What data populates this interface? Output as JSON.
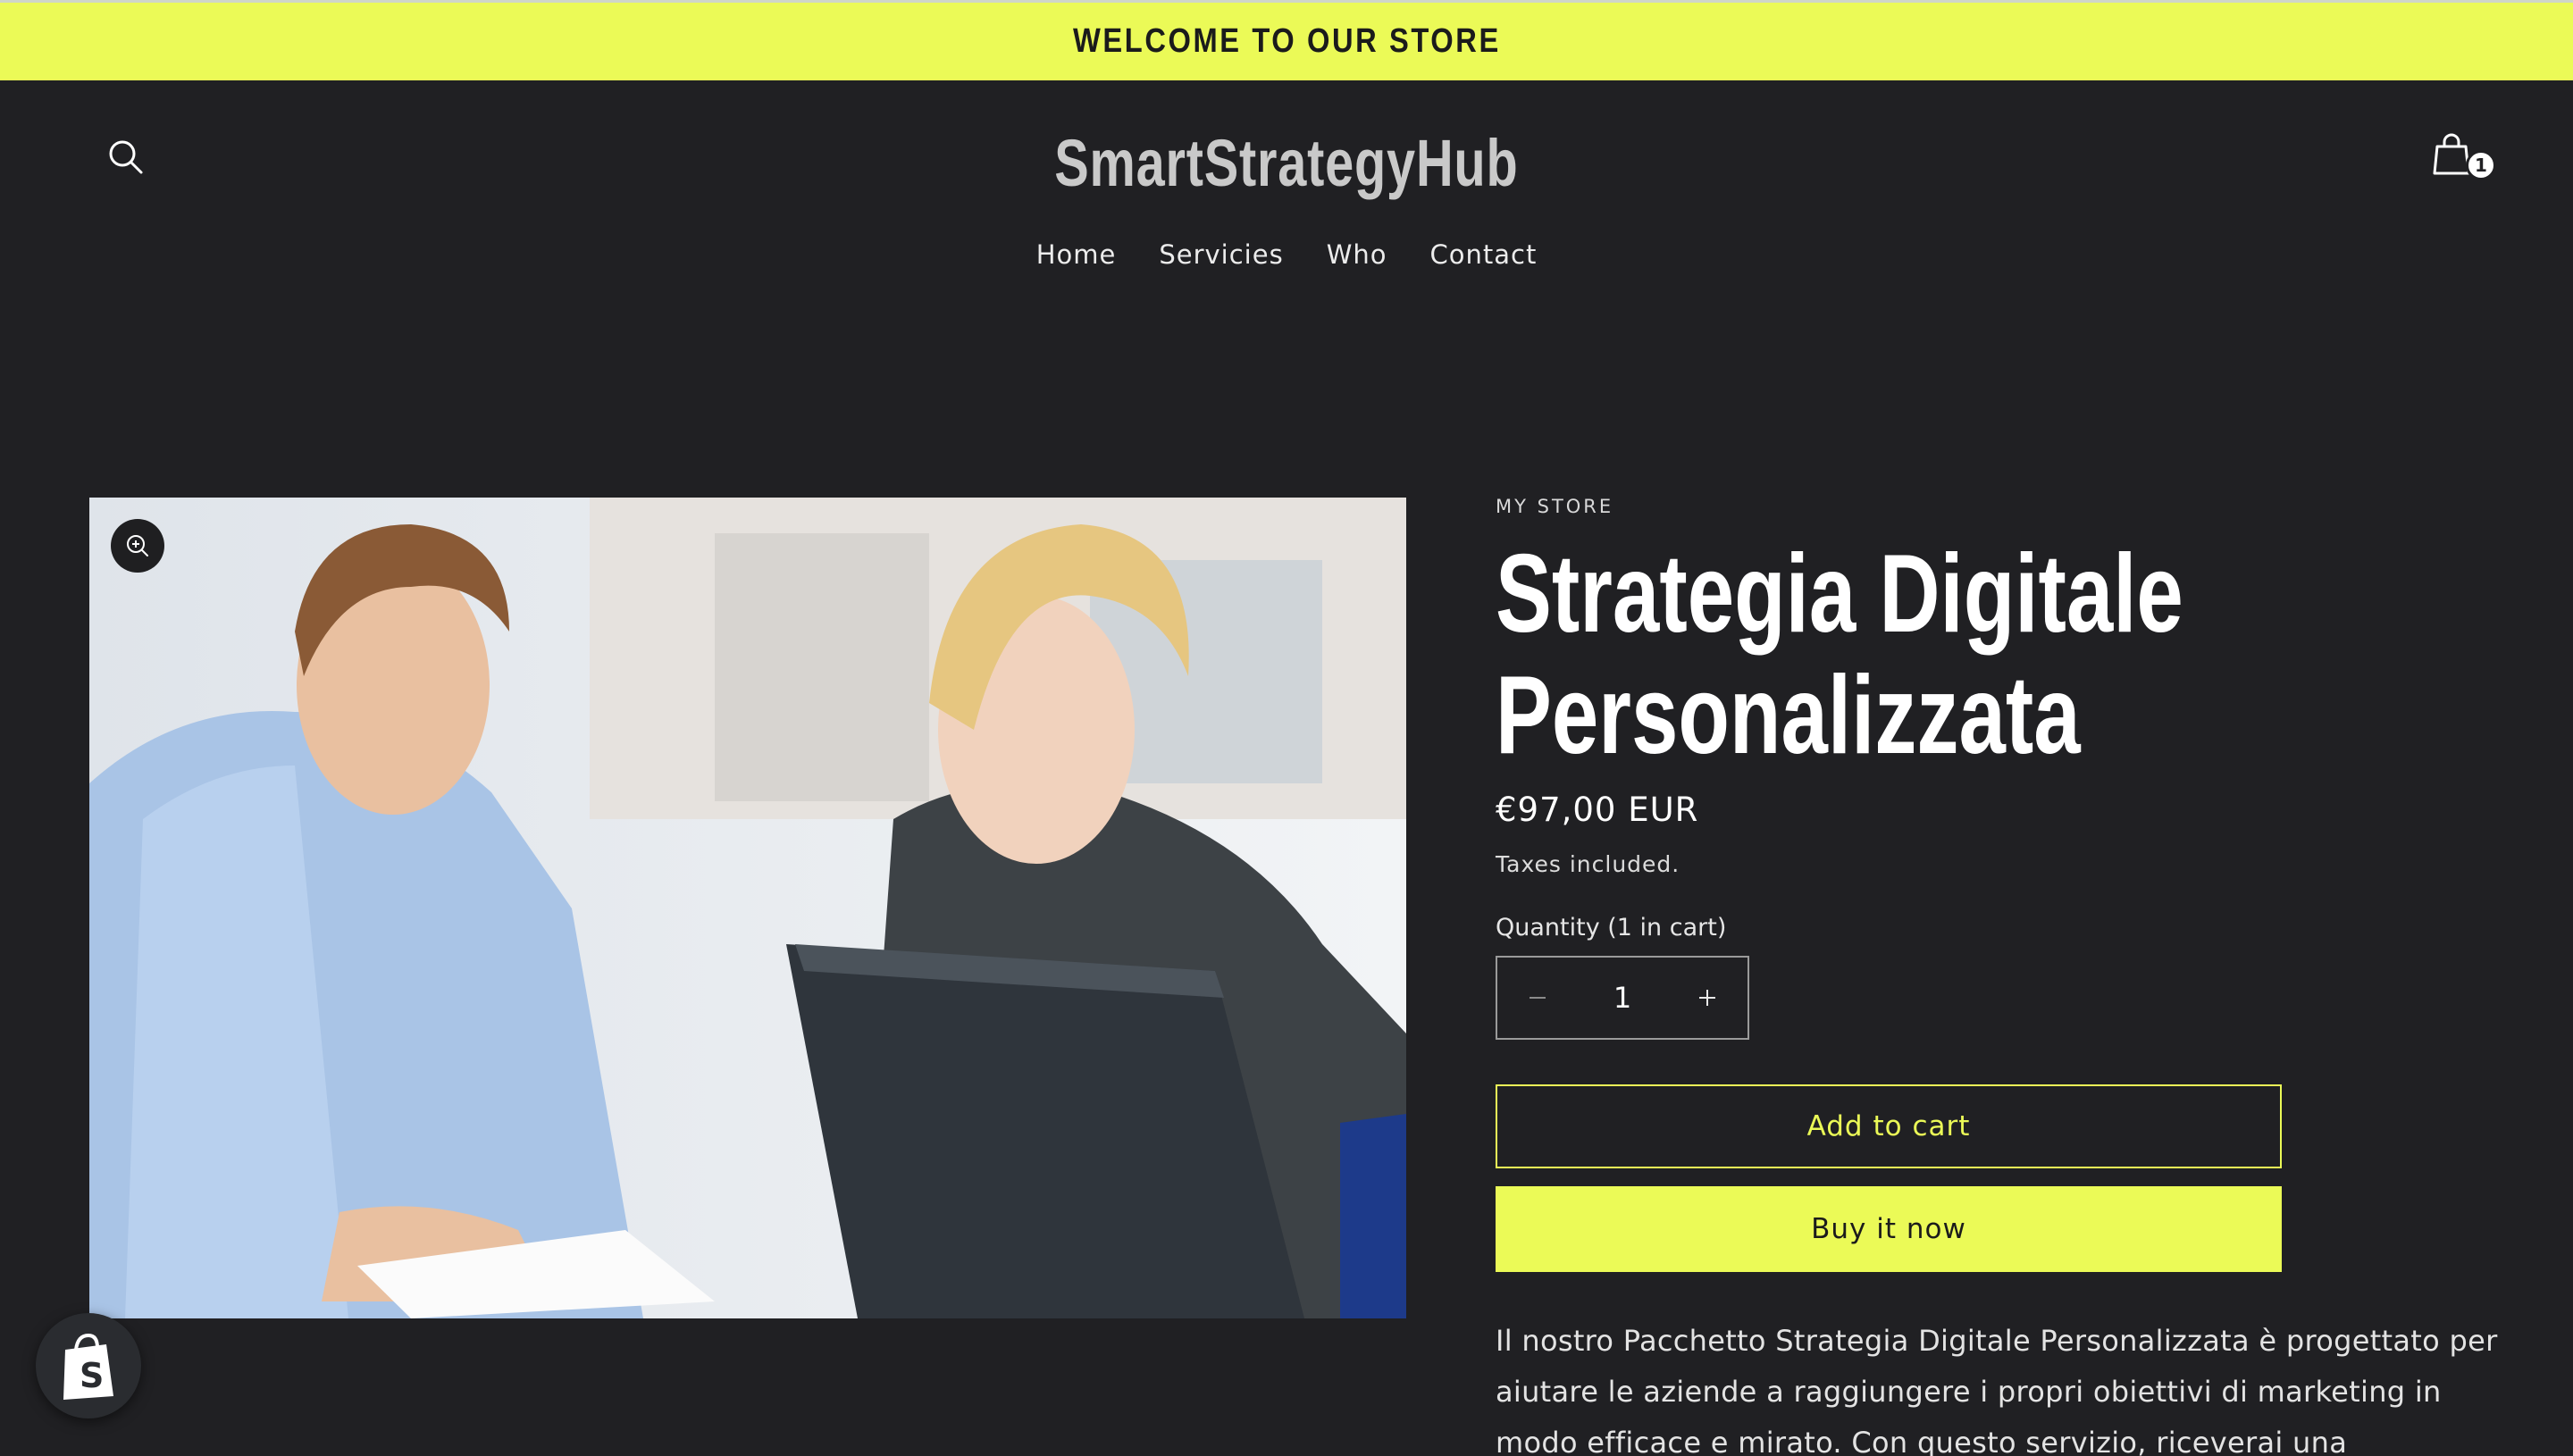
{
  "announcement": {
    "text": "WELCOME TO OUR STORE"
  },
  "header": {
    "logo": "SmartStrategyHub",
    "cart_count": "1",
    "nav": [
      "Home",
      "Servicies",
      "Who",
      "Contact"
    ]
  },
  "product": {
    "vendor": "MY STORE",
    "title": "Strategia Digitale Personalizzata",
    "price": "€97,00 EUR",
    "tax_note": "Taxes included.",
    "quantity_label": "Quantity (1 in cart)",
    "quantity_value": "1",
    "add_to_cart": "Add to cart",
    "buy_now": "Buy it now",
    "description": "Il nostro Pacchetto Strategia Digitale Personalizzata è progettato per aiutare le aziende a raggiungere i propri obiettivi di marketing in modo efficace e mirato. Con questo servizio, riceverai una consulenza"
  },
  "colors": {
    "accent": "#ebfa57",
    "background": "#202023"
  }
}
